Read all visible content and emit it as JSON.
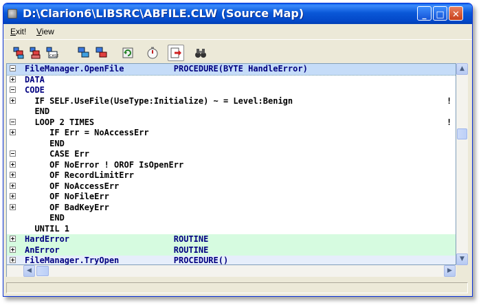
{
  "window": {
    "title": "D:\\Clarion6\\LIBSRC\\ABFILE.CLW (Source Map)",
    "buttons": {
      "minimize": "_",
      "maximize": "□",
      "close": "✕"
    }
  },
  "menu": {
    "items": [
      {
        "label": "Exit!"
      },
      {
        "label": "View"
      }
    ]
  },
  "toolbar": {
    "tools": [
      {
        "icon": "expand-all-icon"
      },
      {
        "icon": "collapse-all-icon"
      },
      {
        "icon": "case-icon"
      },
      {
        "icon": "expand-section-icon"
      },
      {
        "icon": "collapse-section-icon"
      },
      {
        "icon": "refresh-icon"
      },
      {
        "icon": "timer-icon"
      },
      {
        "icon": "export-icon"
      },
      {
        "icon": "binoculars-icon"
      }
    ]
  },
  "code_lines": [
    {
      "expander": "minus",
      "text": "FileManager.OpenFile          PROCEDURE(BYTE HandleError)",
      "style": "sel",
      "mark": ""
    },
    {
      "expander": "plus",
      "text": "DATA",
      "style": "",
      "mark": ""
    },
    {
      "expander": "minus",
      "text": "CODE",
      "style": "",
      "mark": ""
    },
    {
      "expander": "plus",
      "text": "  IF SELF.UseFile(UseType:Initialize) ~ = Level:Benign",
      "style": "",
      "mark": "!"
    },
    {
      "expander": "",
      "text": "  END",
      "style": "",
      "mark": ""
    },
    {
      "expander": "minus",
      "text": "  LOOP 2 TIMES",
      "style": "",
      "mark": "!"
    },
    {
      "expander": "plus",
      "text": "     IF Err = NoAccessErr",
      "style": "",
      "mark": ""
    },
    {
      "expander": "",
      "text": "     END",
      "style": "",
      "mark": ""
    },
    {
      "expander": "minus",
      "text": "     CASE Err",
      "style": "",
      "mark": ""
    },
    {
      "expander": "plus",
      "text": "     OF NoError ! OROF IsOpenErr",
      "style": "",
      "mark": ""
    },
    {
      "expander": "plus",
      "text": "     OF RecordLimitErr",
      "style": "",
      "mark": ""
    },
    {
      "expander": "plus",
      "text": "     OF NoAccessErr",
      "style": "",
      "mark": ""
    },
    {
      "expander": "plus",
      "text": "     OF NoFileErr",
      "style": "",
      "mark": ""
    },
    {
      "expander": "plus",
      "text": "     OF BadKeyErr",
      "style": "",
      "mark": ""
    },
    {
      "expander": "",
      "text": "     END",
      "style": "",
      "mark": ""
    },
    {
      "expander": "",
      "text": "  UNTIL 1",
      "style": "",
      "mark": ""
    },
    {
      "expander": "plus",
      "text": "HardError                     ROUTINE",
      "style": "green",
      "mark": ""
    },
    {
      "expander": "plus",
      "text": "AnError                       ROUTINE",
      "style": "green",
      "mark": ""
    },
    {
      "expander": "plus",
      "text": "FileManager.TryOpen           PROCEDURE()",
      "style": "blue2",
      "mark": ""
    }
  ],
  "scrollbars": {
    "vertical_position": 0.35,
    "horizontal_position": 0.0
  },
  "colors": {
    "selected_row": "#c5dcf8",
    "routine_row": "#d6fbe0",
    "procedure_row": "#e6eefb",
    "keyword": "#000080"
  }
}
